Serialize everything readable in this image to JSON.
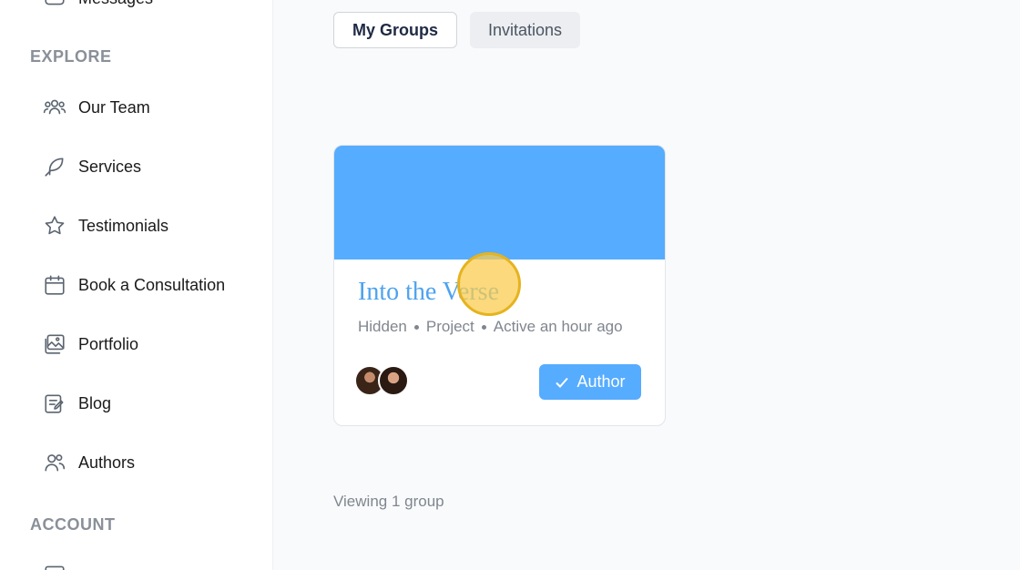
{
  "sidebar": {
    "top_partial_item": "Messages",
    "explore_heading": "EXPLORE",
    "items": [
      {
        "label": "Our Team",
        "icon": "users-group-icon"
      },
      {
        "label": "Services",
        "icon": "feather-icon"
      },
      {
        "label": "Testimonials",
        "icon": "star-icon"
      },
      {
        "label": "Book a Consultation",
        "icon": "calendar-icon"
      },
      {
        "label": "Portfolio",
        "icon": "images-icon"
      },
      {
        "label": "Blog",
        "icon": "note-edit-icon"
      },
      {
        "label": "Authors",
        "icon": "user-pair-icon"
      }
    ],
    "account_heading": "ACCOUNT"
  },
  "tabs": [
    {
      "label": "My Groups",
      "active": true
    },
    {
      "label": "Invitations",
      "active": false
    }
  ],
  "group_card": {
    "title": "Into the Verse",
    "meta": [
      "Hidden",
      "Project",
      "Active an hour ago"
    ],
    "role_button": "Author",
    "cover_color": "#56acfe",
    "member_count": 2
  },
  "footer": {
    "count_text": "Viewing 1 group"
  },
  "colors": {
    "accent": "#56acfe",
    "title_link": "#4da3ee"
  }
}
